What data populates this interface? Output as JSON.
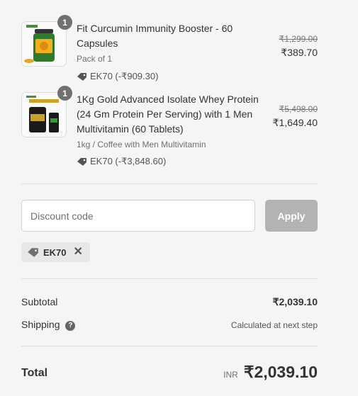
{
  "items": [
    {
      "quantity": "1",
      "title": "Fit Curcumin Immunity Booster - 60 Capsules",
      "variant": "Pack of 1",
      "discount": "EK70 (-₹909.30)",
      "price_old": "₹1,299.00",
      "price_new": "₹389.70"
    },
    {
      "quantity": "1",
      "title": "1Kg Gold Advanced Isolate Whey Protein (24 Gm Protein Per Serving) with 1 Men Multivitamin (60 Tablets)",
      "variant": "1kg / Coffee with Men Multivitamin",
      "discount": "EK70 (-₹3,848.60)",
      "price_old": "₹5,498.00",
      "price_new": "₹1,649.40"
    }
  ],
  "discount": {
    "placeholder": "Discount code",
    "apply_label": "Apply",
    "applied_code": "EK70"
  },
  "summary": {
    "subtotal_label": "Subtotal",
    "subtotal_value": "₹2,039.10",
    "shipping_label": "Shipping",
    "shipping_value": "Calculated at next step",
    "total_label": "Total",
    "total_currency": "INR",
    "total_value": "₹2,039.10"
  },
  "colors": {
    "apply_disabled": "#b3b3b3",
    "badge": "#707070",
    "product1_jar": "#2f7a2a",
    "product2_tub": "#1a1a1a"
  },
  "icons": [
    "tag-icon",
    "close-icon",
    "question-icon"
  ]
}
